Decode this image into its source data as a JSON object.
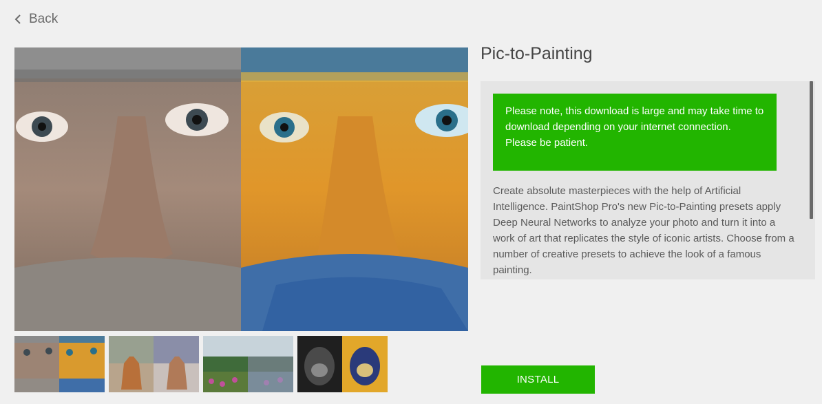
{
  "nav": {
    "back_label": "Back"
  },
  "product": {
    "title": "Pic-to-Painting",
    "notice": "Please note, this download is large and may take time to download depending on your internet connection. Please be patient.",
    "description": "Create absolute masterpieces with the help of Artificial Intelligence. PaintShop Pro's new Pic-to-Painting presets apply Deep Neural Networks to analyze your photo and turn it into a work of art that replicates the style of iconic artists. Choose from a number of creative presets to achieve the look of a famous painting."
  },
  "actions": {
    "install_label": "INSTALL"
  },
  "gallery": {
    "hero": {
      "subject": "old man face, photo vs painted"
    },
    "thumbnails": [
      {
        "subject": "old man face"
      },
      {
        "subject": "fox"
      },
      {
        "subject": "lake landscape with flowers"
      },
      {
        "subject": "gorilla"
      }
    ]
  },
  "colors": {
    "accent_green": "#22b500",
    "background": "#f0f0f0",
    "panel": "#e5e5e5"
  }
}
